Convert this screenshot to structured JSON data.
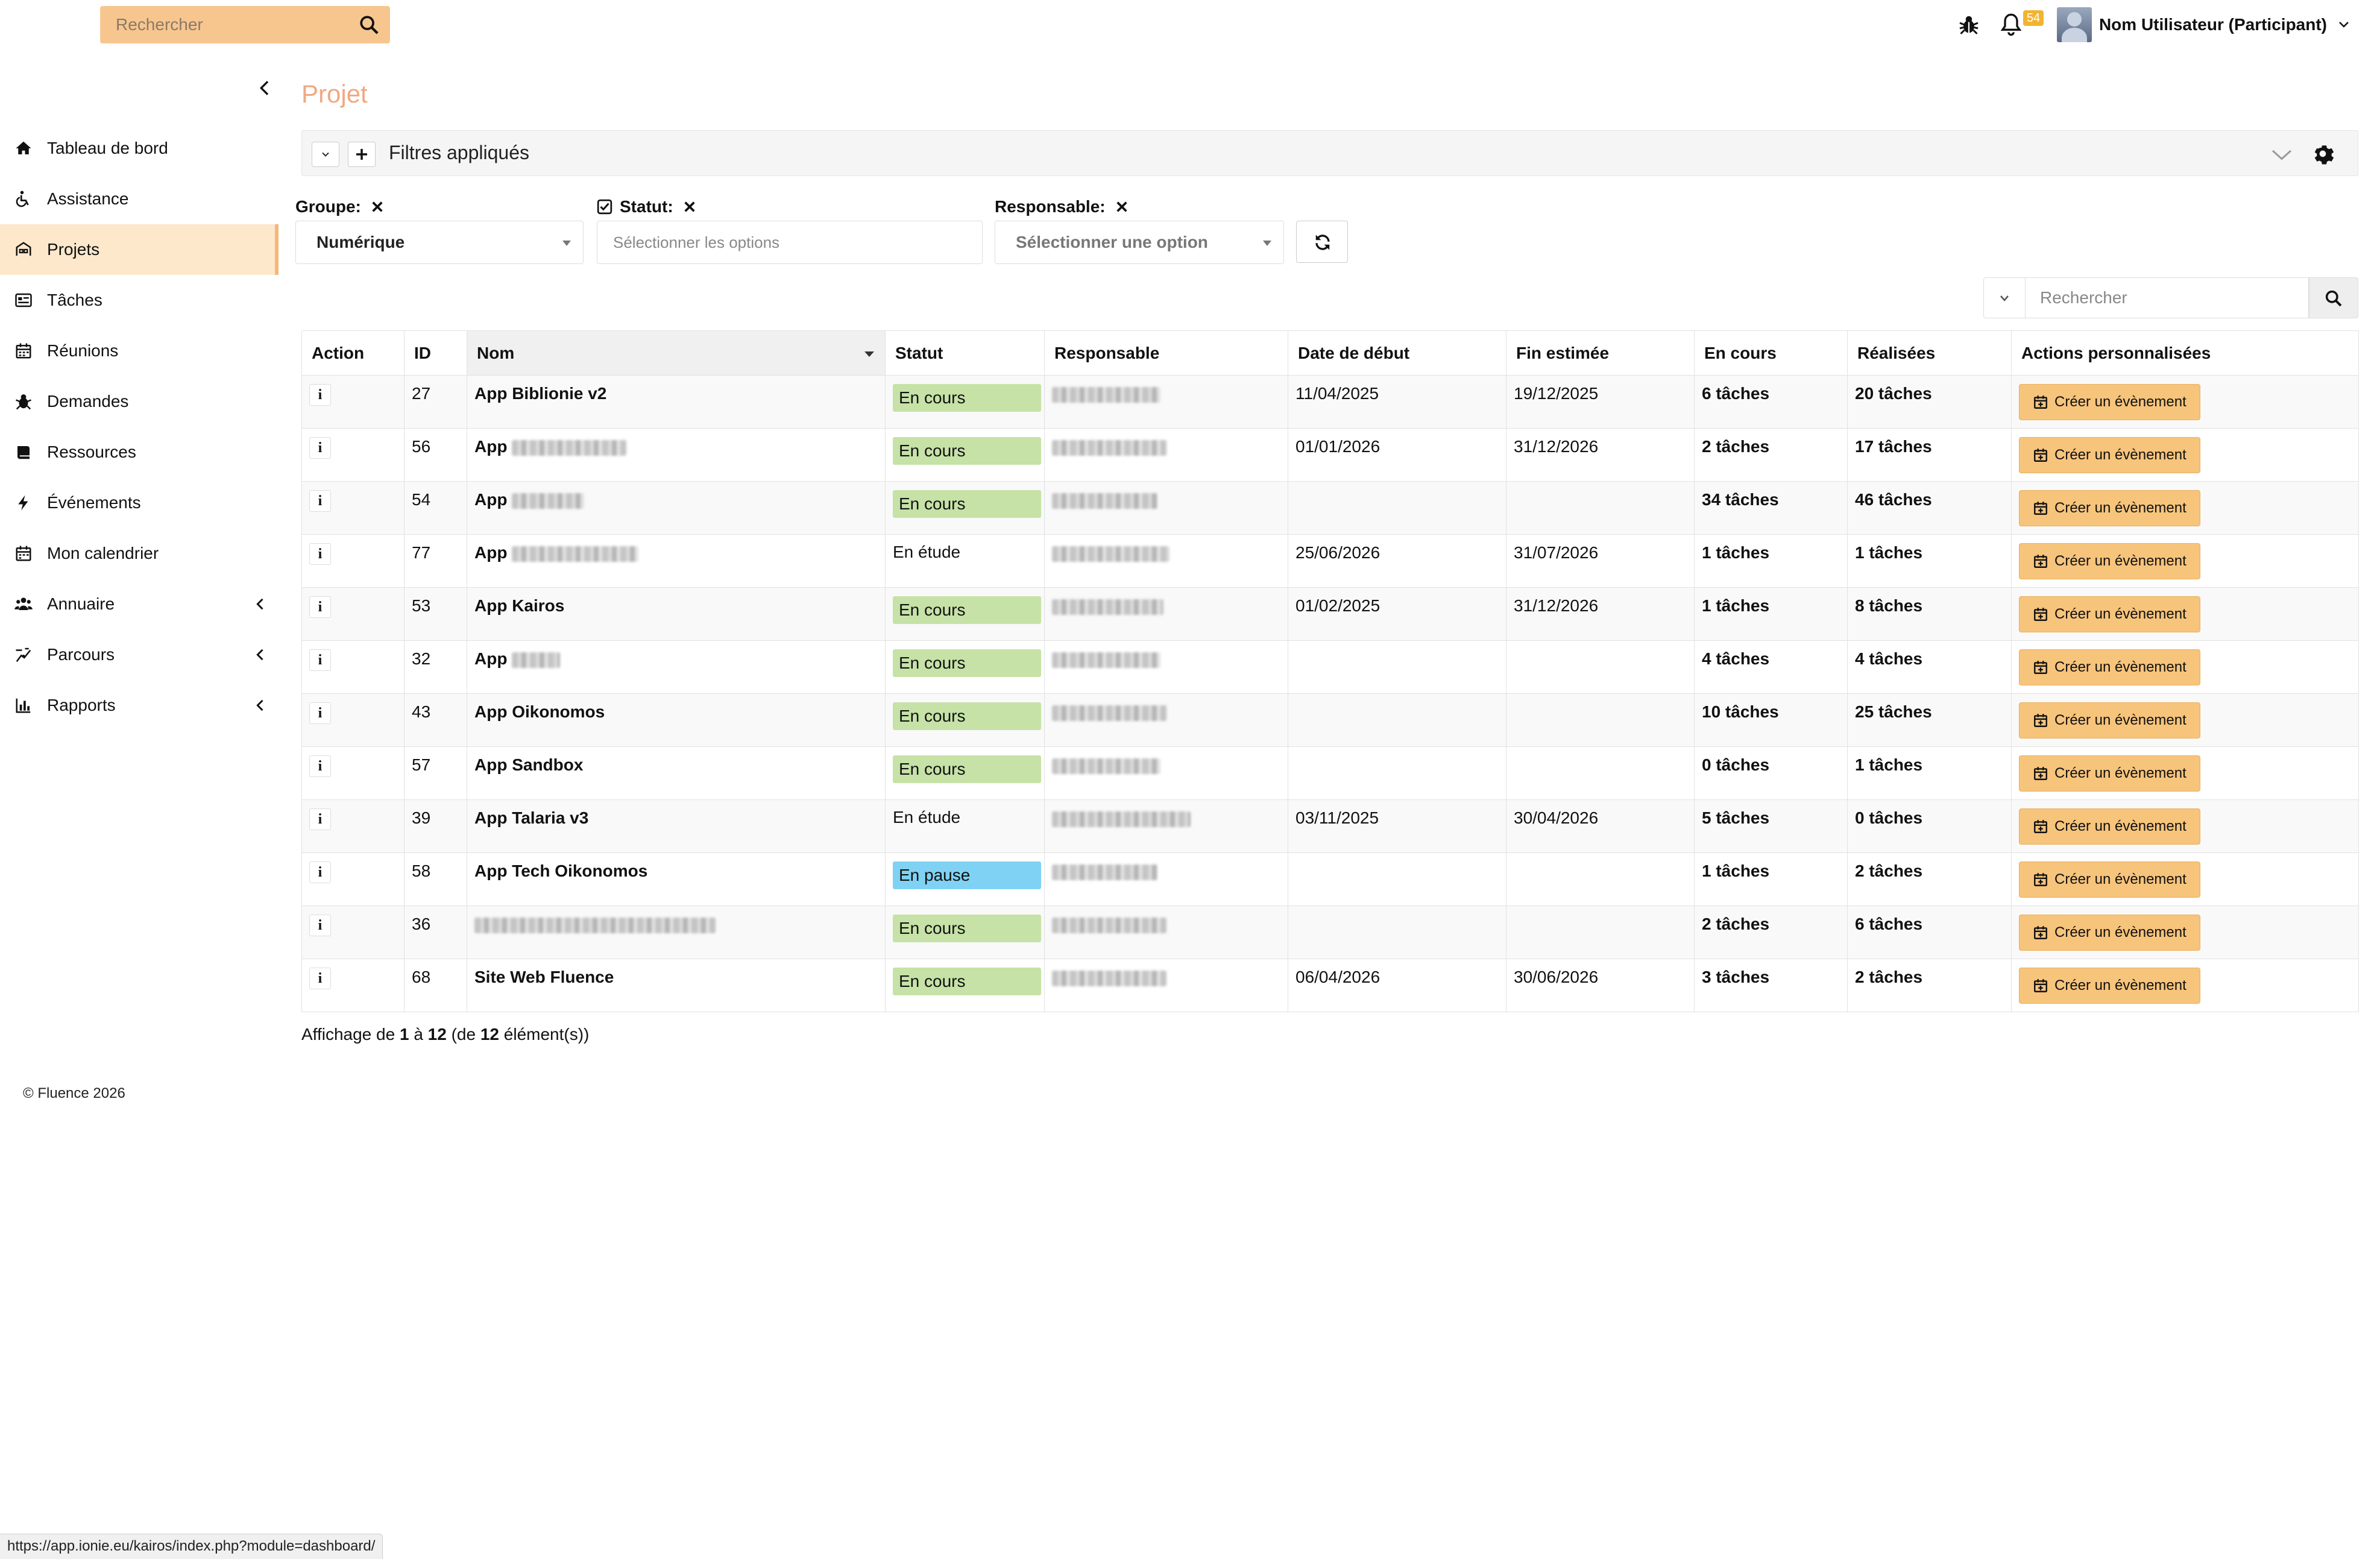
{
  "topbar": {
    "search_placeholder": "Rechercher",
    "notifications_count": "54",
    "user_name": "Nom Utilisateur (Participant)"
  },
  "sidebar": {
    "items": [
      {
        "label": "Tableau de bord",
        "icon": "home-icon"
      },
      {
        "label": "Assistance",
        "icon": "wheelchair-icon"
      },
      {
        "label": "Projets",
        "icon": "projects-icon",
        "active": true
      },
      {
        "label": "Tâches",
        "icon": "tasks-icon"
      },
      {
        "label": "Réunions",
        "icon": "calendar-icon"
      },
      {
        "label": "Demandes",
        "icon": "bug-icon"
      },
      {
        "label": "Ressources",
        "icon": "book-icon"
      },
      {
        "label": "Événements",
        "icon": "bolt-icon"
      },
      {
        "label": "Mon calendrier",
        "icon": "calendar-icon"
      },
      {
        "label": "Annuaire",
        "icon": "users-icon",
        "expandable": true
      },
      {
        "label": "Parcours",
        "icon": "path-icon",
        "expandable": true
      },
      {
        "label": "Rapports",
        "icon": "bar-chart-icon",
        "expandable": true
      }
    ]
  },
  "page": {
    "title": "Projet",
    "filters_label": "Filtres appliqués"
  },
  "filters": {
    "groupe": {
      "label": "Groupe:",
      "value": "Numérique"
    },
    "statut": {
      "label": "Statut:",
      "placeholder": "Sélectionner les options"
    },
    "responsable": {
      "label": "Responsable:",
      "value": "Sélectionner une option"
    }
  },
  "table_search": {
    "placeholder": "Rechercher"
  },
  "table": {
    "headers": [
      "Action",
      "ID",
      "Nom",
      "Statut",
      "Responsable",
      "Date de début",
      "Fin estimée",
      "En cours",
      "Réalisées",
      "Actions personnalisées"
    ],
    "rows": [
      {
        "id": "27",
        "name": "App Biblionie v2",
        "status": "En cours",
        "status_type": "ec",
        "start": "11/04/2025",
        "end": "19/12/2025",
        "in_progress": "6 tâches",
        "done": "20 tâches"
      },
      {
        "id": "56",
        "name": "App",
        "name_blurred": true,
        "status": "En cours",
        "status_type": "ec",
        "start": "01/01/2026",
        "end": "31/12/2026",
        "in_progress": "2 tâches",
        "done": "17 tâches"
      },
      {
        "id": "54",
        "name": "App",
        "name_blurred": true,
        "status": "En cours",
        "status_type": "ec",
        "start": "",
        "end": "",
        "in_progress": "34 tâches",
        "done": "46 tâches"
      },
      {
        "id": "77",
        "name": "App",
        "name_blurred": true,
        "status": "En étude",
        "status_type": "plain",
        "start": "25/06/2026",
        "end": "31/07/2026",
        "in_progress": "1 tâches",
        "done": "1 tâches"
      },
      {
        "id": "53",
        "name": "App Kairos",
        "status": "En cours",
        "status_type": "ec",
        "start": "01/02/2025",
        "end": "31/12/2026",
        "in_progress": "1 tâches",
        "done": "8 tâches"
      },
      {
        "id": "32",
        "name": "App",
        "name_blurred": true,
        "status": "En cours",
        "status_type": "ec",
        "start": "",
        "end": "",
        "in_progress": "4 tâches",
        "done": "4 tâches"
      },
      {
        "id": "43",
        "name": "App Oikonomos",
        "status": "En cours",
        "status_type": "ec",
        "start": "",
        "end": "",
        "in_progress": "10 tâches",
        "done": "25 tâches"
      },
      {
        "id": "57",
        "name": "App Sandbox",
        "status": "En cours",
        "status_type": "ec",
        "start": "",
        "end": "",
        "in_progress": "0 tâches",
        "done": "1 tâches"
      },
      {
        "id": "39",
        "name": "App Talaria v3",
        "status": "En étude",
        "status_type": "plain",
        "start": "03/11/2025",
        "end": "30/04/2026",
        "in_progress": "5 tâches",
        "done": "0 tâches"
      },
      {
        "id": "58",
        "name": "App Tech Oikonomos",
        "status": "En pause",
        "status_type": "ep",
        "start": "",
        "end": "",
        "in_progress": "1 tâches",
        "done": "2 tâches"
      },
      {
        "id": "36",
        "name": "",
        "name_blurred": true,
        "status": "En cours",
        "status_type": "ec",
        "start": "",
        "end": "",
        "in_progress": "2 tâches",
        "done": "6 tâches"
      },
      {
        "id": "68",
        "name": "Site Web Fluence",
        "status": "En cours",
        "status_type": "ec",
        "start": "06/04/2026",
        "end": "30/06/2026",
        "in_progress": "3 tâches",
        "done": "2 tâches"
      }
    ],
    "action_button_label": "Créer un évènement"
  },
  "table_info": {
    "prefix": "Affichage de",
    "from": "1",
    "to_word": "à",
    "to": "12",
    "of_open": "(de",
    "total": "12",
    "suffix": "élément(s))"
  },
  "footer": {
    "copyright": "© Fluence 2026"
  },
  "statusbar": {
    "url": "https://app.ionie.eu/kairos/index.php?module=dashboard/"
  },
  "colors": {
    "accent": "#f7c68f",
    "title": "#f0a883",
    "status_en_cours": "#c6e2a7",
    "status_en_pause": "#7fd2f3",
    "event_button": "#f7c47b"
  }
}
